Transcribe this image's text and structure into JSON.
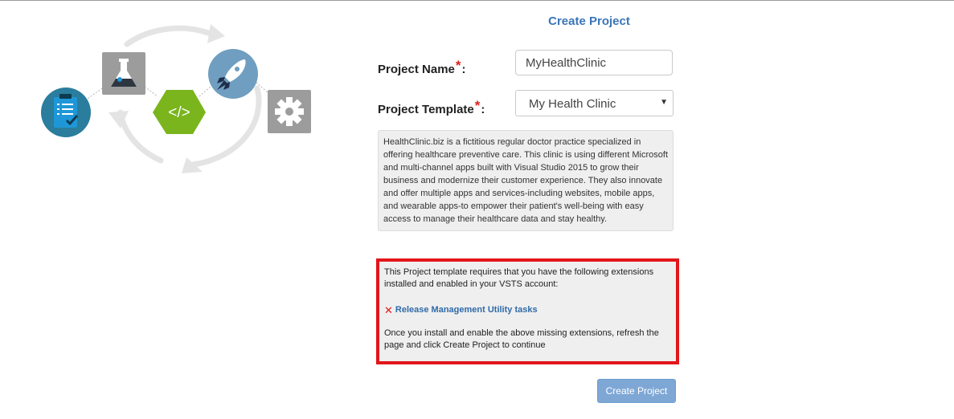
{
  "form": {
    "heading": "Create Project",
    "project_name_label": "Project Name",
    "project_name_value": "MyHealthClinic",
    "project_template_label": "Project Template",
    "project_template_value": "My Health Clinic",
    "required_marker": "*",
    "colon": ":",
    "description": "HealthClinic.biz is a fictitious regular doctor practice specialized in offering healthcare preventive care. This clinic is using different Microsoft and multi-channel apps built with Visual Studio 2015 to grow their business and modernize their customer experience. They also innovate and offer multiple apps and services-including websites, mobile apps, and wearable apps-to empower their patient's well-being with easy access to manage their healthcare data and stay healthy.",
    "create_button": "Create Project"
  },
  "extensions": {
    "intro": "This Project template requires that you have the following extensions installed and enabled in your VSTS account:",
    "missing": [
      {
        "name": "Release Management Utility tasks",
        "status_icon": "x-icon"
      }
    ],
    "footer": "Once you install and enable the above missing extensions, refresh the page and click Create Project to continue"
  },
  "illustration": {
    "icons": [
      "clipboard-icon",
      "flask-icon",
      "code-icon",
      "rocket-icon",
      "gear-icon",
      "cycle-arrows-icon"
    ],
    "code_glyph": "</>",
    "colors": {
      "teal": "#2a7d9c",
      "grey": "#9c9c9c",
      "green": "#7ab51d",
      "rocket_blue": "#6f9ec0",
      "accent_blue": "#3a75b8",
      "alert_red": "#e2161b"
    }
  }
}
